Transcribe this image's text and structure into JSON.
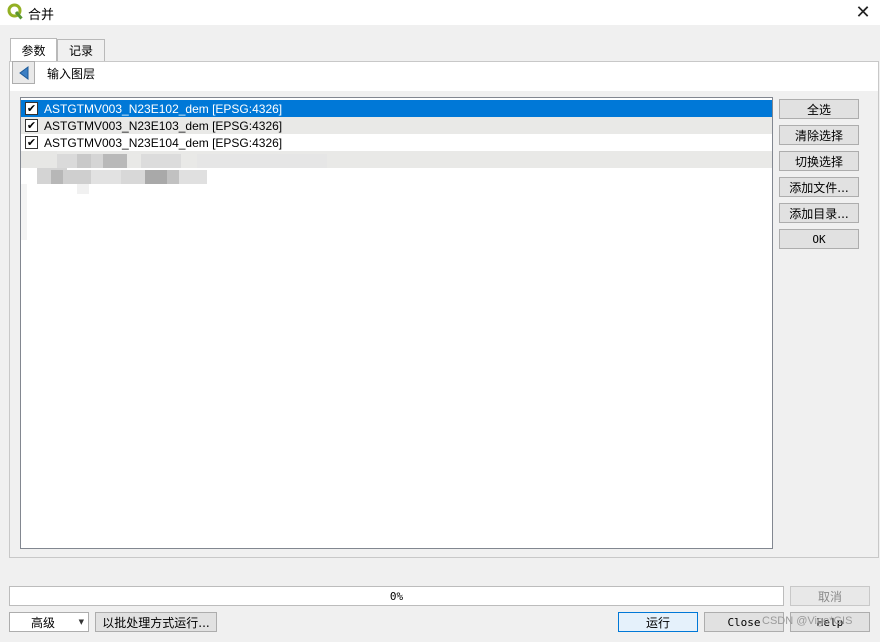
{
  "window": {
    "title": "合并",
    "close_glyph": "✕"
  },
  "tabs": [
    {
      "label": "参数",
      "active": true
    },
    {
      "label": "记录",
      "active": false
    }
  ],
  "panel": {
    "title": "输入图层"
  },
  "layers": [
    {
      "label": "ASTGTMV003_N23E102_dem [EPSG:4326]",
      "checked": true,
      "selected": true
    },
    {
      "label": "ASTGTMV003_N23E103_dem [EPSG:4326]",
      "checked": true,
      "selected": false
    },
    {
      "label": "ASTGTMV003_N23E104_dem [EPSG:4326]",
      "checked": true,
      "selected": false
    }
  ],
  "side_buttons": {
    "select_all": "全选",
    "clear_selection": "清除选择",
    "toggle_selection": "切换选择",
    "add_files": "添加文件...",
    "add_directory": "添加目录...",
    "ok": "OK"
  },
  "progress": {
    "text": "0%",
    "value": 0
  },
  "bottom": {
    "cancel": "取消",
    "advanced": "高级",
    "batch": "以批处理方式运行...",
    "run": "运行",
    "close": "Close",
    "help": "Help"
  },
  "watermark": "CSDN @Vigo*GIS",
  "colors": {
    "selection": "#0078d7",
    "qgis_green": "#93b023"
  }
}
